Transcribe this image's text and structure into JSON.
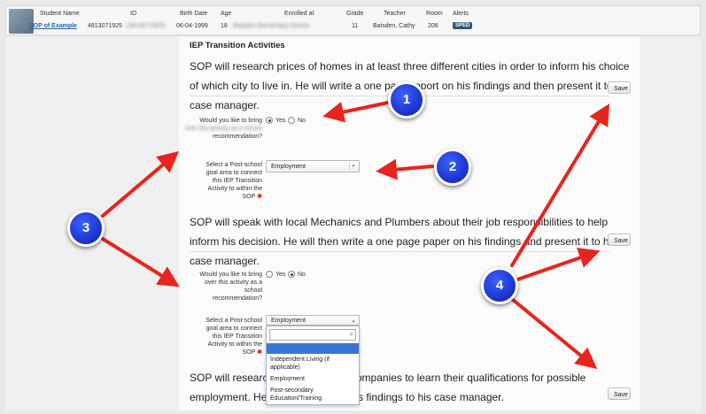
{
  "student": {
    "headers": {
      "name": "Student Name",
      "id": "ID",
      "birth_date": "Birth Date",
      "age": "Age",
      "enrolled": "Enrolled at",
      "grade": "Grade",
      "teacher": "Teacher",
      "room": "Room",
      "alerts": "Alerts"
    },
    "values": {
      "name": "SOP of Example",
      "id": "4813071925",
      "id_blurred": "(4813071925)",
      "birth_date": "06-04-1999",
      "age": "18",
      "enrolled": "Baisden Elementary School",
      "grade": "11",
      "teacher": "Baisden, Cathy",
      "room": "208",
      "alert_badge": "SPED"
    }
  },
  "section_title": "IEP Transition Activities",
  "activities": [
    {
      "text": "SOP will research prices of homes in at least three different cities in order to inform his choice of which city to live in. He will write a one page report on his findings and then present it to his case manager.",
      "save_label": "Save"
    },
    {
      "text": "SOP will speak with local Mechanics and Plumbers about their job responsibilities to help inform his decision. He will then write a one page paper on his findings and present it to his case manager.",
      "save_label": "Save"
    },
    {
      "text": "SOP will research local insurance companies to learn their qualifications for possible employment. He will then present his findings to his case manager.",
      "save_label": "Save"
    }
  ],
  "recommend_q1_lines": [
    "Would you like to bring",
    "over this activity as a school",
    "recommendation?"
  ],
  "recommend_q2_lines": [
    "Would you like to bring",
    "over this activity as a",
    "school",
    "recommendation?"
  ],
  "goal_q_lines": [
    "Select a Post-school",
    "goal area to connect",
    "this IEP Transition",
    "Activity to within the",
    "SOP"
  ],
  "radio_yes": "Yes",
  "radio_no": "No",
  "select1_value": "Employment",
  "select2_value": "Employment",
  "dropdown_options": [
    "",
    "Independent Living (if applicable)",
    "Employment",
    "Post-secondary Education/Training"
  ],
  "markers": [
    "1",
    "2",
    "3",
    "4"
  ],
  "colors": {
    "arrow": "#e8241c",
    "marker": "#1a2fc8",
    "badge": "#33587a",
    "link": "#2a62a8"
  }
}
